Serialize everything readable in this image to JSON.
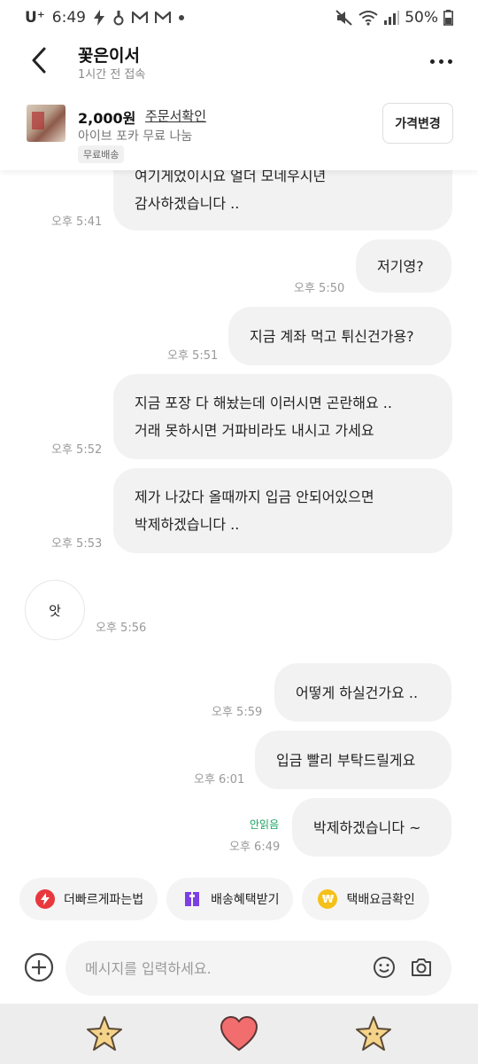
{
  "status": {
    "carrier": "U⁺",
    "time": "6:49",
    "battery": "50%",
    "icons": [
      "bolt-icon",
      "hand-icon",
      "gmail-icon",
      "gmail-icon",
      "dot-icon",
      "mute-icon",
      "wifi-icon",
      "signal-icon",
      "battery-icon"
    ]
  },
  "header": {
    "title": "꽃은이서",
    "subtitle": "1시간 전 접속"
  },
  "product": {
    "price": "2,000원",
    "order_link": "주문서확인",
    "name": "아이브 포카 무료 나눔",
    "shipping_badge": "무료배송",
    "price_button": "가격변경"
  },
  "messages": [
    {
      "side": "left",
      "lines": [
        "여기게었이시요 얼더 모네우시년",
        "감사하겠습니다 .."
      ],
      "time": "오후 5:41"
    },
    {
      "side": "right",
      "lines": [
        "저기영?"
      ],
      "time": "오후 5:50"
    },
    {
      "side": "right",
      "lines": [
        "지금 계좌 먹고 튀신건가용?"
      ],
      "time": "오후 5:51"
    },
    {
      "side": "left",
      "lines": [
        "지금 포장 다 해놨는데 이러시면 곤란해요 ..",
        "거래 못하시면 거파비라도 내시고 가세요"
      ],
      "time": "오후 5:52"
    },
    {
      "side": "left",
      "lines": [
        "제가 나갔다 올때까지 입금 안되어있으면",
        "박제하겠습니다 .."
      ],
      "time": "오후 5:53"
    },
    {
      "side": "left",
      "lines": [
        "앗"
      ],
      "time": "오후 5:56",
      "avatar": true
    },
    {
      "side": "right",
      "lines": [
        "어떻게 하실건가요 .."
      ],
      "time": "오후 5:59"
    },
    {
      "side": "right",
      "lines": [
        "입금 빨리 부탁드릴게요"
      ],
      "time": "오후 6:01"
    },
    {
      "side": "right",
      "lines": [
        "박제하겠습니다 ~"
      ],
      "time": "오후 6:49",
      "read": "안읽음"
    }
  ],
  "quick_actions": [
    {
      "label": "더빠르게파는법",
      "icon": "lightning-icon",
      "color": "#e8383d"
    },
    {
      "label": "배송혜택받기",
      "icon": "box-icon",
      "color": "#7b3fe4"
    },
    {
      "label": "택배요금확인",
      "icon": "won-coin-icon",
      "color": "#f5c018"
    }
  ],
  "input": {
    "placeholder": "메시지를 입력하세요."
  },
  "stickers": [
    "star-sticker-icon",
    "heart-sticker-icon",
    "star-sticker-icon"
  ],
  "colors": {
    "bubble": "#f2f2f2",
    "read_green": "#1aa260",
    "heart": "#f26d6d",
    "star": "#f5d48a"
  }
}
